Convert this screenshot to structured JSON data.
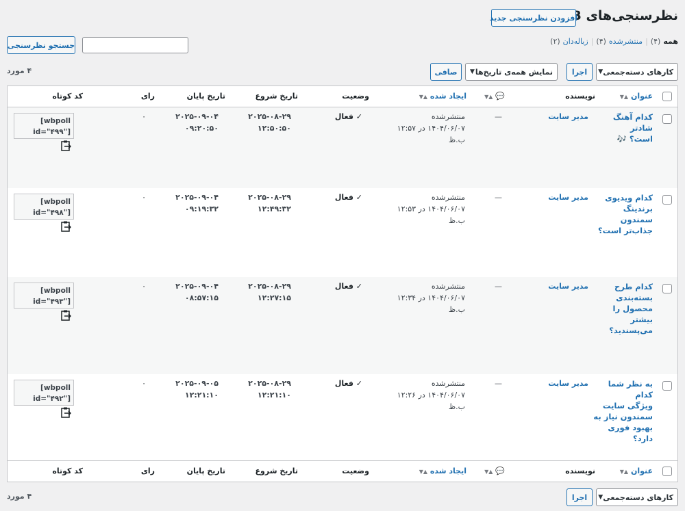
{
  "header": {
    "title": "نظرسنجی‌های WB",
    "add_new_label": "افزودن نظرسنجی جدید"
  },
  "filters": {
    "all_label": "همه",
    "all_count": "(۴)",
    "published_label": "منتشرشده",
    "published_count": "(۴)",
    "trash_label": "زباله‌دان",
    "trash_count": "(۲)"
  },
  "search": {
    "value": "",
    "button_label": "جستجو نظرسنجی"
  },
  "tablenav": {
    "bulk_actions": "کارهای دسته‌جمعی",
    "apply_label": "اجرا",
    "dates_filter": "نمایش همه‌ی تاریخ‌ها",
    "filter_label": "صافی",
    "items_count": "۴ مورد"
  },
  "columns": {
    "title": "عنوان",
    "author": "نویسنده",
    "created": "ایجاد شده",
    "status": "وضعیت",
    "start_date": "تاریخ شروع",
    "end_date": "تاریخ پایان",
    "votes": "رای",
    "shortcode": "کد کوتاه"
  },
  "rows": [
    {
      "title_lines": [
        "کدام آهنگ شادتر",
        "است؟ 🎶"
      ],
      "author": "مدیر سایت",
      "comments": "—",
      "date_status": "منتشرشده",
      "date_value": "۱۴۰۴/۰۶/۰۷ در ۱۲:۵۷",
      "date_suffix": "ب.ظ",
      "status": "فعال",
      "start_date": "۲۰۲۵-۰۸-۲۹",
      "start_time": "۱۲:۵۰:۵۰",
      "end_date": "۲۰۲۵-۰۹-۰۴",
      "end_time": "۰۹:۲۰:۵۰",
      "votes": "۰",
      "shortcode_line1": "[wbpoll",
      "shortcode_line2": "id=\"۴۹۹\"]"
    },
    {
      "title_lines": [
        "کدام ویدیوی",
        "برندینگ سمندون",
        "جذاب‌تر است؟"
      ],
      "author": "مدیر سایت",
      "comments": "—",
      "date_status": "منتشرشده",
      "date_value": "۱۴۰۴/۰۶/۰۷ در ۱۲:۵۳",
      "date_suffix": "ب.ظ",
      "status": "فعال",
      "start_date": "۲۰۲۵-۰۸-۲۹",
      "start_time": "۱۲:۴۹:۳۲",
      "end_date": "۲۰۲۵-۰۹-۰۴",
      "end_time": "۰۹:۱۹:۳۲",
      "votes": "۰",
      "shortcode_line1": "[wbpoll",
      "shortcode_line2": "id=\"۴۹۸\"]"
    },
    {
      "title_lines": [
        "کدام طرح",
        "بسته‌بندی",
        "محصول را بیشتر",
        "می‌پسندید؟"
      ],
      "author": "مدیر سایت",
      "comments": "—",
      "date_status": "منتشرشده",
      "date_value": "۱۴۰۴/۰۶/۰۷ در ۱۲:۳۴",
      "date_suffix": "ب.ظ",
      "status": "فعال",
      "start_date": "۲۰۲۵-۰۸-۲۹",
      "start_time": "۱۲:۲۷:۱۵",
      "end_date": "۲۰۲۵-۰۹-۰۴",
      "end_time": "۰۸:۵۷:۱۵",
      "votes": "۰",
      "shortcode_line1": "[wbpoll",
      "shortcode_line2": "id=\"۴۹۳\"]"
    },
    {
      "title_lines": [
        "به نظر شما کدام",
        "ویژگی سایت",
        "سمندون نیاز به",
        "بهبود فوری دارد؟"
      ],
      "author": "مدیر سایت",
      "comments": "—",
      "date_status": "منتشرشده",
      "date_value": "۱۴۰۴/۰۶/۰۷ در ۱۲:۲۶",
      "date_suffix": "ب.ظ",
      "status": "فعال",
      "start_date": "۲۰۲۵-۰۸-۲۹",
      "start_time": "۱۲:۲۱:۱۰",
      "end_date": "۲۰۲۵-۰۹-۰۵",
      "end_time": "۱۲:۲۱:۱۰",
      "votes": "۰",
      "shortcode_line1": "[wbpoll",
      "shortcode_line2": "id=\"۴۹۲\"]"
    }
  ]
}
